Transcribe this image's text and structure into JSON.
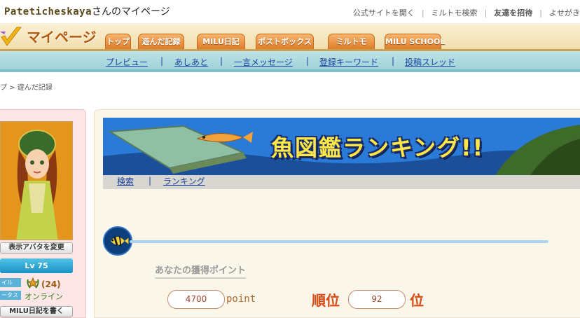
{
  "header": {
    "username": "Pateticheskaya",
    "username_suffix": "さんのマイページ",
    "links": [
      "公式サイトを開く",
      "ミルトモ検索",
      "友達を招待",
      "よせがき"
    ]
  },
  "nav": {
    "logo_text": "マイページ",
    "tabs": [
      "トップ",
      "遊んだ記録",
      "MILU日記",
      "ポストボックス",
      "ミルトモ",
      "MILU SCHOOL"
    ],
    "active_tab": "遊んだ記録"
  },
  "subnav": {
    "items": [
      "プレビュー",
      "あしあと",
      "一言メッセージ",
      "登録キーワード",
      "投稿スレッド"
    ],
    "separator": "|"
  },
  "breadcrumb": "プ > 遊んだ記録",
  "profile": {
    "change_avatar_label": "表示アバタを変更",
    "level": "Lv 75",
    "label_style": "イル",
    "label_status": "ータス",
    "count": "(24)",
    "status": "オンライン",
    "write_diary_label": "MILU日記を書く"
  },
  "content": {
    "banner_title": "魚図鑑ランキング!!",
    "banner_tabs": [
      "検索",
      "ランキング"
    ],
    "banner_tab_separator": "|",
    "points_label": "あなたの獲得ポイント",
    "points_value": "4700",
    "points_unit": "point",
    "rank_label": "順位",
    "rank_value": "92",
    "rank_unit": "位"
  },
  "colors": {
    "accent_orange": "#de7d2a",
    "subnav_teal": "#9ed3d8",
    "invite_link": "#c8105a",
    "rank_red": "#d94a14",
    "banner_blue": "#1d6fd0"
  }
}
